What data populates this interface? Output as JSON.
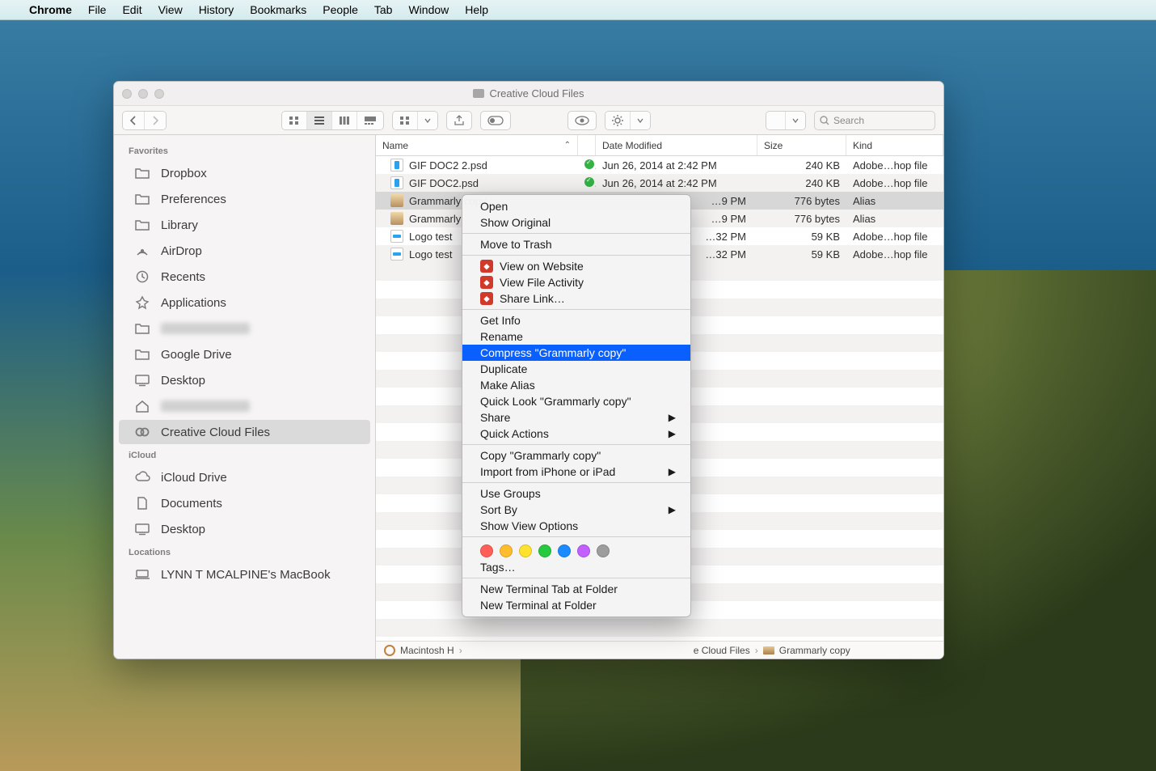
{
  "menubar": {
    "app": "Chrome",
    "items": [
      "File",
      "Edit",
      "View",
      "History",
      "Bookmarks",
      "People",
      "Tab",
      "Window",
      "Help"
    ]
  },
  "finder": {
    "title": "Creative Cloud Files",
    "search_placeholder": "Search",
    "columns": {
      "name": "Name",
      "date": "Date Modified",
      "size": "Size",
      "kind": "Kind"
    },
    "sidebar": {
      "favorites_header": "Favorites",
      "icloud_header": "iCloud",
      "locations_header": "Locations",
      "favorites": [
        {
          "label": "Dropbox",
          "icon": "folder"
        },
        {
          "label": "Preferences",
          "icon": "folder"
        },
        {
          "label": "Library",
          "icon": "folder"
        },
        {
          "label": "AirDrop",
          "icon": "airdrop"
        },
        {
          "label": "Recents",
          "icon": "recents"
        },
        {
          "label": "Applications",
          "icon": "apps"
        },
        {
          "label": "",
          "icon": "folder",
          "blur": true
        },
        {
          "label": "Google Drive",
          "icon": "folder"
        },
        {
          "label": "Desktop",
          "icon": "desktop"
        },
        {
          "label": "",
          "icon": "home",
          "blur": true
        },
        {
          "label": "Creative Cloud Files",
          "icon": "cc",
          "selected": true
        }
      ],
      "icloud": [
        {
          "label": "iCloud Drive",
          "icon": "cloud"
        },
        {
          "label": "Documents",
          "icon": "doc"
        },
        {
          "label": "Desktop",
          "icon": "desktop"
        }
      ],
      "locations": [
        {
          "label": "LYNN T MCALPINE's MacBook",
          "icon": "laptop"
        }
      ]
    },
    "files": [
      {
        "name": "GIF DOC2 2.psd",
        "icon": "psd",
        "sync": true,
        "date": "Jun 26, 2014 at 2:42 PM",
        "size": "240 KB",
        "kind": "Adobe…hop file"
      },
      {
        "name": "GIF DOC2.psd",
        "icon": "psd",
        "sync": true,
        "date": "Jun 26, 2014 at 2:42 PM",
        "size": "240 KB",
        "kind": "Adobe…hop file"
      },
      {
        "name": "Grammarly copy",
        "icon": "alias",
        "date_tail": "9 PM",
        "size": "776 bytes",
        "kind": "Alias",
        "selected": true
      },
      {
        "name": "Grammarly",
        "icon": "alias",
        "date_tail": "9 PM",
        "size": "776 bytes",
        "kind": "Alias"
      },
      {
        "name": "Logo test",
        "icon": "psd-o",
        "date_tail": "32 PM",
        "size": "59 KB",
        "kind": "Adobe…hop file"
      },
      {
        "name": "Logo test",
        "icon": "psd-o",
        "date_tail": "32 PM",
        "size": "59 KB",
        "kind": "Adobe…hop file"
      }
    ],
    "path": {
      "segments": [
        "Macintosh H",
        "e Cloud Files",
        "Grammarly copy"
      ]
    }
  },
  "context_menu": {
    "groups": [
      [
        {
          "label": "Open"
        },
        {
          "label": "Show Original"
        }
      ],
      [
        {
          "label": "Move to Trash"
        }
      ],
      [
        {
          "label": "View on Website",
          "cc": true
        },
        {
          "label": "View File Activity",
          "cc": true
        },
        {
          "label": "Share Link…",
          "cc": true
        }
      ],
      [
        {
          "label": "Get Info"
        },
        {
          "label": "Rename"
        },
        {
          "label": "Compress \"Grammarly copy\"",
          "highlight": true
        },
        {
          "label": "Duplicate"
        },
        {
          "label": "Make Alias"
        },
        {
          "label": "Quick Look \"Grammarly copy\""
        },
        {
          "label": "Share",
          "sub": true
        },
        {
          "label": "Quick Actions",
          "sub": true
        }
      ],
      [
        {
          "label": "Copy \"Grammarly copy\""
        },
        {
          "label": "Import from iPhone or iPad",
          "sub": true
        }
      ],
      [
        {
          "label": "Use Groups"
        },
        {
          "label": "Sort By",
          "sub": true
        },
        {
          "label": "Show View Options"
        }
      ],
      [
        {
          "tags": [
            "#ff5f56",
            "#ffbd2e",
            "#ffe22e",
            "#27c93f",
            "#1b8cff",
            "#c160ff",
            "#9d9d9d"
          ]
        },
        {
          "label": "Tags…"
        }
      ],
      [
        {
          "label": "New Terminal Tab at Folder"
        },
        {
          "label": "New Terminal at Folder"
        }
      ]
    ]
  }
}
